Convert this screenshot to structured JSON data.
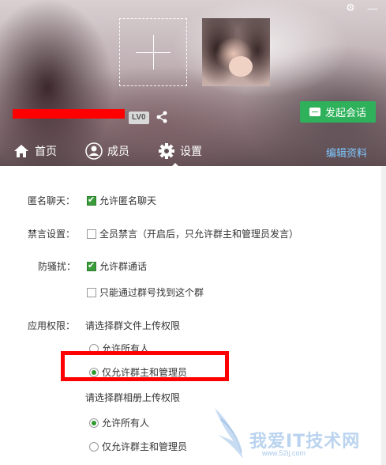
{
  "header": {
    "level_badge": "LV0",
    "start_chat_label": "发起会话",
    "nav": {
      "home": "首页",
      "members": "成员",
      "settings": "设置",
      "edit": "编辑资料"
    }
  },
  "settings": {
    "anon_label": "匿名聊天：",
    "anon_option": "允许匿名聊天",
    "anon_checked": true,
    "mute_label": "禁言设置：",
    "mute_option": "全员禁言（开启后，只允许群主和管理员发言）",
    "mute_checked": false,
    "anti_label": "防骚扰：",
    "anti_option1": "允许群通话",
    "anti_option1_checked": true,
    "anti_option2": "只能通过群号找到这个群",
    "anti_option2_checked": false,
    "perm_label": "应用权限：",
    "file_title": "请选择群文件上传权限",
    "file_opt1": "允许所有人",
    "file_opt2": "仅允许群主和管理员",
    "file_selected": "file_opt2",
    "album_title": "请选择群相册上传权限",
    "album_opt1": "允许所有人",
    "album_opt2": "仅允许群主和管理员",
    "album_selected": "album_opt1"
  },
  "watermark": {
    "text": "我爱IT技术网",
    "url": "www.52ij.com"
  },
  "colors": {
    "accent_green": "#2eb15a",
    "highlight_red": "#ff0000",
    "link_blue": "#7ec8ff"
  }
}
